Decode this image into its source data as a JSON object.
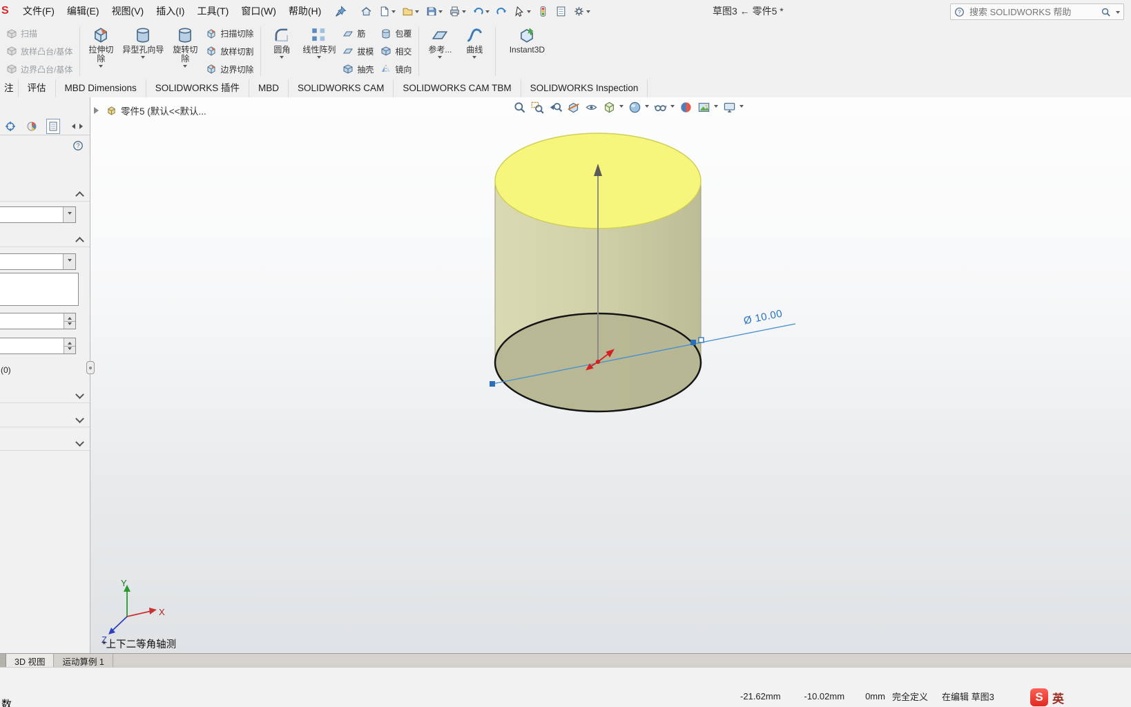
{
  "window": {
    "logo_fragment": "S",
    "title": "草图3 ← 零件5 *"
  },
  "menubar": {
    "items": [
      "文件(F)",
      "编辑(E)",
      "视图(V)",
      "插入(I)",
      "工具(T)",
      "窗口(W)",
      "帮助(H)"
    ],
    "pin_icon": "pin-icon",
    "quick_access_icons": [
      "home-icon",
      "new-document-icon",
      "open-icon",
      "save-icon",
      "print-icon",
      "undo-icon",
      "redo-icon",
      "select-arrow-icon",
      "rebuild-icon",
      "file-properties-icon",
      "options-gear-icon"
    ],
    "search": {
      "placeholder": "搜索 SOLIDWORKS 帮助",
      "help_icon": "help-icon",
      "magnifier_icon": "search-icon"
    }
  },
  "ribbon": {
    "boss_group": [
      {
        "label": "扫描",
        "icon": "sweep-icon"
      },
      {
        "label": "放样凸台/基体",
        "icon": "loft-icon"
      },
      {
        "label": "边界凸台/基体",
        "icon": "boundary-boss-icon"
      }
    ],
    "cut_big": [
      {
        "label": "拉伸切除",
        "icon": "extruded-cut-icon"
      },
      {
        "label": "异型孔向导",
        "icon": "hole-wizard-icon"
      },
      {
        "label": "旋转切除",
        "icon": "revolved-cut-icon"
      }
    ],
    "cut_stack": [
      {
        "label": "扫描切除",
        "icon": "swept-cut-icon"
      },
      {
        "label": "放样切割",
        "icon": "lofted-cut-icon"
      },
      {
        "label": "边界切除",
        "icon": "boundary-cut-icon"
      }
    ],
    "feature_big": [
      {
        "label": "圆角",
        "icon": "fillet-icon"
      },
      {
        "label": "线性阵列",
        "icon": "linear-pattern-icon"
      }
    ],
    "feature_stack_a": [
      {
        "label": "筋",
        "icon": "rib-icon"
      },
      {
        "label": "拔模",
        "icon": "draft-icon"
      },
      {
        "label": "抽壳",
        "icon": "shell-icon"
      }
    ],
    "feature_stack_b": [
      {
        "label": "包覆",
        "icon": "wrap-icon"
      },
      {
        "label": "相交",
        "icon": "intersect-icon"
      },
      {
        "label": "镜向",
        "icon": "mirror-icon"
      }
    ],
    "reference_big": [
      {
        "label": "参考...",
        "icon": "reference-geometry-icon"
      },
      {
        "label": "曲线",
        "icon": "curves-icon"
      }
    ],
    "instant3d": {
      "label": "Instant3D",
      "icon": "instant3d-icon"
    }
  },
  "ribbon_tabs": {
    "items": [
      "注",
      "评估",
      "MBD Dimensions",
      "SOLIDWORKS 插件",
      "MBD",
      "SOLIDWORKS CAM",
      "SOLIDWORKS CAM TBM",
      "SOLIDWORKS Inspection"
    ]
  },
  "left_panel": {
    "tab_icons": [
      "target-tab-icon",
      "display-manager-icon",
      "active-pane-icon"
    ],
    "help_icon": "help-icon",
    "count_label": "(0)"
  },
  "viewport": {
    "doc_label": "零件5 (默认<<默认...",
    "view_label": "*上下二等角轴测",
    "dimension_text": "Ø 10.00",
    "axis_labels": {
      "x": "X",
      "y": "Y",
      "z": "Z"
    },
    "headsup_icons": [
      "zoom-fit-icon",
      "zoom-area-icon",
      "previous-view-icon",
      "section-view-icon",
      "annotation-view-icon",
      "view-orientation-icon",
      "display-style-icon",
      "hide-show-items-icon",
      "edit-appearance-icon",
      "apply-scene-icon",
      "view-settings-icon"
    ]
  },
  "colors": {
    "top_face": "#f5f578",
    "body": "#cdcda6",
    "selection_blue": "#3a7cc4",
    "sketch_black": "#151515",
    "origin_red": "#cc2222"
  },
  "bottom_tabs": {
    "items": [
      "3D 视图",
      "运动算例 1"
    ]
  },
  "status": {
    "left_fragment": "数",
    "x": "-21.62mm",
    "y": "-10.02mm",
    "z": "0mm",
    "state": "完全定义",
    "mode": "在编辑 草图3"
  },
  "ime": {
    "logo_letter": "S",
    "mode": "英"
  }
}
